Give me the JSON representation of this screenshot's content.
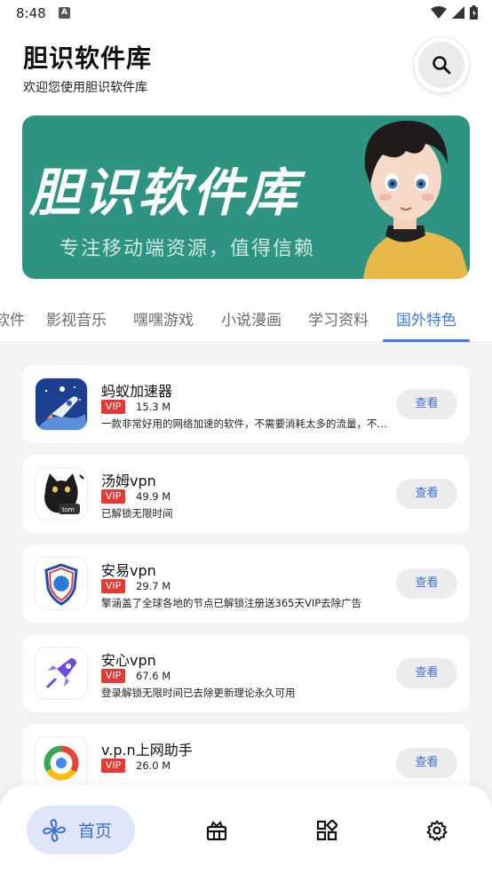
{
  "status_bar": {
    "time": "8:48",
    "notification_badge": "A"
  },
  "header": {
    "title": "胆识软件库",
    "subtitle": "欢迎您使用胆识软件库",
    "search_icon": "search-icon"
  },
  "banner": {
    "title": "胆识软件库",
    "subtitle": "专注移动端资源，值得信赖"
  },
  "tabs": {
    "items": [
      "软件",
      "影视音乐",
      "嘿嘿游戏",
      "小说漫画",
      "学习资料",
      "国外特色"
    ],
    "active": "国外特色"
  },
  "apps": [
    {
      "name": "蚂蚁加速器",
      "badge": "VIP",
      "size": "15.3 M",
      "desc": "一款非常好用的网络加速的软件，不需要消耗太多的流量，不会对手机",
      "button": "查看"
    },
    {
      "name": "汤姆vpn",
      "badge": "VIP",
      "size": "49.9 M",
      "desc": "已解锁无限时间",
      "button": "查看"
    },
    {
      "name": "安易vpn",
      "badge": "VIP",
      "size": "29.7 M",
      "desc": "擎涵盖了全球各地的节点已解锁注册送365天VIP去除广告",
      "button": "查看"
    },
    {
      "name": "安心vpn",
      "badge": "VIP",
      "size": "67.6 M",
      "desc": "登录解锁无限时间已去除更新理论永久可用",
      "button": "查看"
    },
    {
      "name": "v.p.n上网助手",
      "badge": "VIP",
      "size": "26.0 M",
      "desc": "",
      "button": "查看"
    }
  ],
  "bottom_nav": {
    "home_label": "首页",
    "items": [
      "home-icon",
      "gift-box-icon",
      "apps-grid-icon",
      "settings-gear-icon"
    ]
  },
  "colors": {
    "accent": "#3f7cf0",
    "banner_bg": "#2f9382",
    "vip_red": "#e53935",
    "page_bg": "#f3f3f5"
  }
}
